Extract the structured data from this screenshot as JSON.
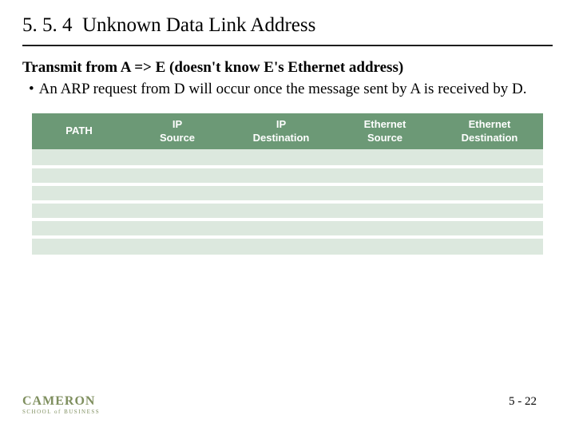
{
  "section_number": "5. 5. 4",
  "section_title": "Unknown Data Link Address",
  "subtitle": "Transmit from A => E (doesn't know E's Ethernet address)",
  "bullet": "An ARP request from D will occur once the message sent by A is received by D.",
  "table": {
    "headers": [
      "PATH",
      "IP Source",
      "IP Destination",
      "Ethernet Source",
      "Ethernet Destination"
    ],
    "row_count": 6
  },
  "logo": {
    "line1": "CAMERON",
    "line2": "SCHOOL of BUSINESS"
  },
  "page_number": "5 - 22"
}
